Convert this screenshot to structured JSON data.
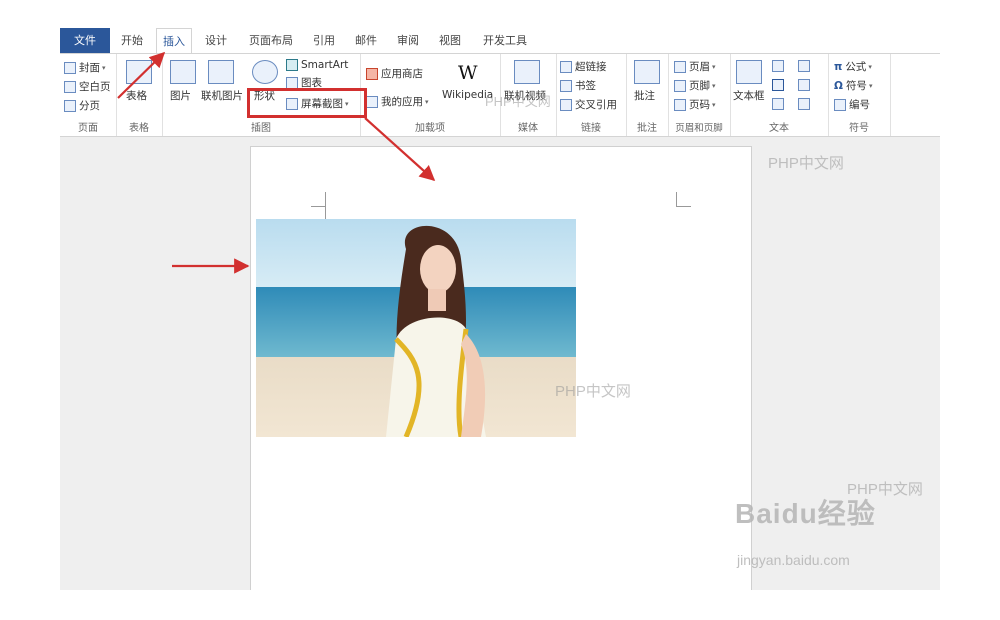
{
  "tabs": [
    {
      "label": "文件"
    },
    {
      "label": "开始"
    },
    {
      "label": "插入"
    },
    {
      "label": "设计"
    },
    {
      "label": "页面布局"
    },
    {
      "label": "引用"
    },
    {
      "label": "邮件"
    },
    {
      "label": "审阅"
    },
    {
      "label": "视图"
    },
    {
      "label": "开发工具"
    }
  ],
  "ribbon": {
    "pages": {
      "cover": "封面",
      "blank": "空白页",
      "break": "分页",
      "label": "页面"
    },
    "tables": {
      "table": "表格",
      "label": "表格"
    },
    "illustrations": {
      "picture": "图片",
      "online_picture": "联机图片",
      "shapes": "形状",
      "smartart": "SmartArt",
      "chart": "图表",
      "screenshot": "屏幕截图",
      "label": "插图"
    },
    "addins": {
      "store": "应用商店",
      "my_apps": "我的应用",
      "wikipedia": "Wikipedia",
      "label": "加载项"
    },
    "media": {
      "online_video": "联机视频",
      "label": "媒体"
    },
    "links": {
      "hyperlink": "超链接",
      "bookmark": "书签",
      "cross_ref": "交叉引用",
      "label": "链接"
    },
    "comments": {
      "comment": "批注",
      "label": "批注"
    },
    "header_footer": {
      "header": "页眉",
      "footer": "页脚",
      "page_number": "页码",
      "label": "页眉和页脚"
    },
    "text": {
      "textbox": "文本框",
      "label": "文本"
    },
    "symbols": {
      "equation": "公式",
      "symbol": "符号",
      "number": "编号",
      "label": "符号"
    }
  },
  "watermarks": {
    "php": "PHP中文网",
    "baidu": "Baidu经验",
    "baidu_url": "jingyan.baidu.com"
  }
}
